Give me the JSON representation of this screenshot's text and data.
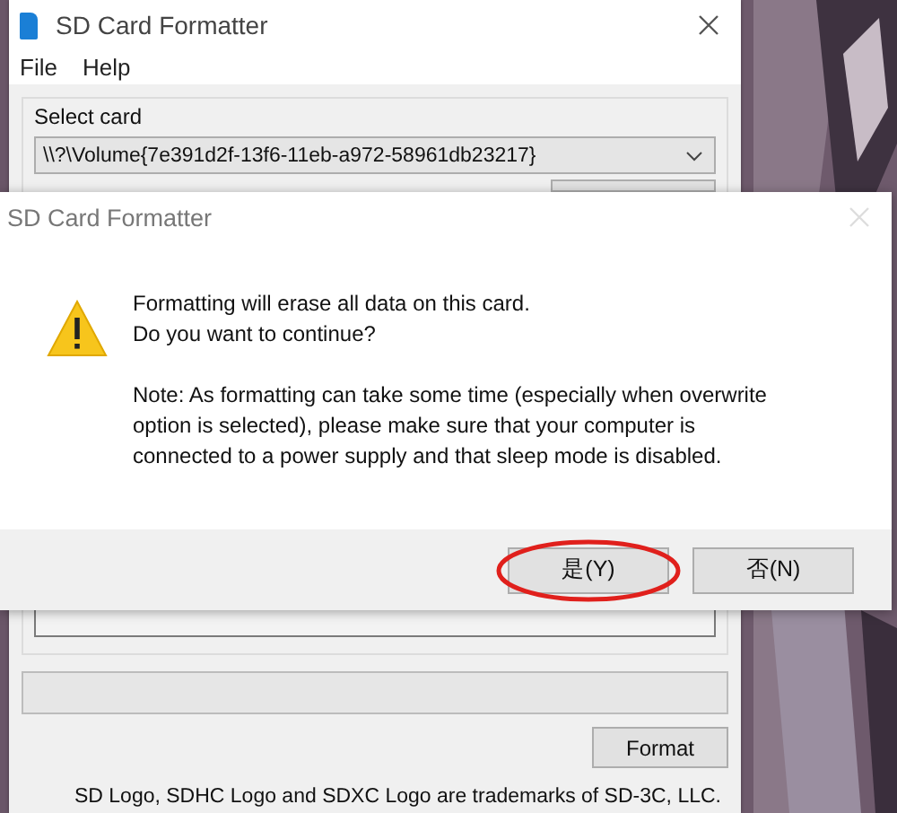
{
  "main_window": {
    "title": "SD Card Formatter",
    "menu": [
      "File",
      "Help"
    ],
    "select_card": {
      "label": "Select card",
      "value": "\\\\?\\Volume{7e391d2f-13f6-11eb-a972-58961db23217}"
    },
    "format_button": "Format",
    "footer": "SD Logo, SDHC Logo and SDXC Logo are trademarks of SD-3C, LLC."
  },
  "dialog": {
    "title": "SD Card Formatter",
    "messages": [
      "Formatting will erase all data on this card.\nDo you want to continue?",
      "Note: As formatting can take some time (especially when overwrite option is selected), please make sure that your computer is connected to a power supply and that sleep mode is disabled."
    ],
    "buttons": [
      {
        "label": "是(Y)",
        "circled": true
      },
      {
        "label": "否(N)",
        "circled": false
      }
    ]
  }
}
